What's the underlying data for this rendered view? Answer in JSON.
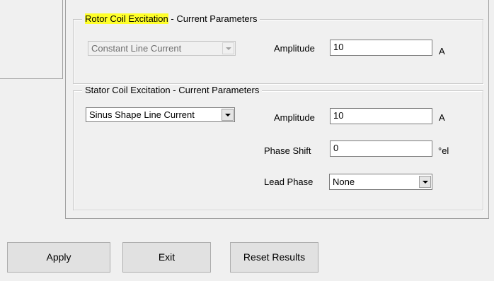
{
  "rotor": {
    "title_highlighted": "Rotor Coil Excitation",
    "title_rest": " - Current Parameters",
    "mode_selected": "Constant Line Current",
    "amplitude_label": "Amplitude",
    "amplitude_value": "10",
    "amplitude_unit": "A"
  },
  "stator": {
    "title": "Stator Coil Excitation - Current Parameters",
    "mode_selected": "Sinus Shape Line Current",
    "amplitude_label": "Amplitude",
    "amplitude_value": "10",
    "amplitude_unit": "A",
    "phase_shift_label": "Phase Shift",
    "phase_shift_value": "0",
    "phase_shift_unit": "°el",
    "lead_phase_label": "Lead Phase",
    "lead_phase_selected": "None"
  },
  "buttons": {
    "apply": "Apply",
    "exit": "Exit",
    "reset": "Reset Results"
  },
  "colors": {
    "highlight": "#ffff2a",
    "window_bg": "#f0f0f0"
  }
}
